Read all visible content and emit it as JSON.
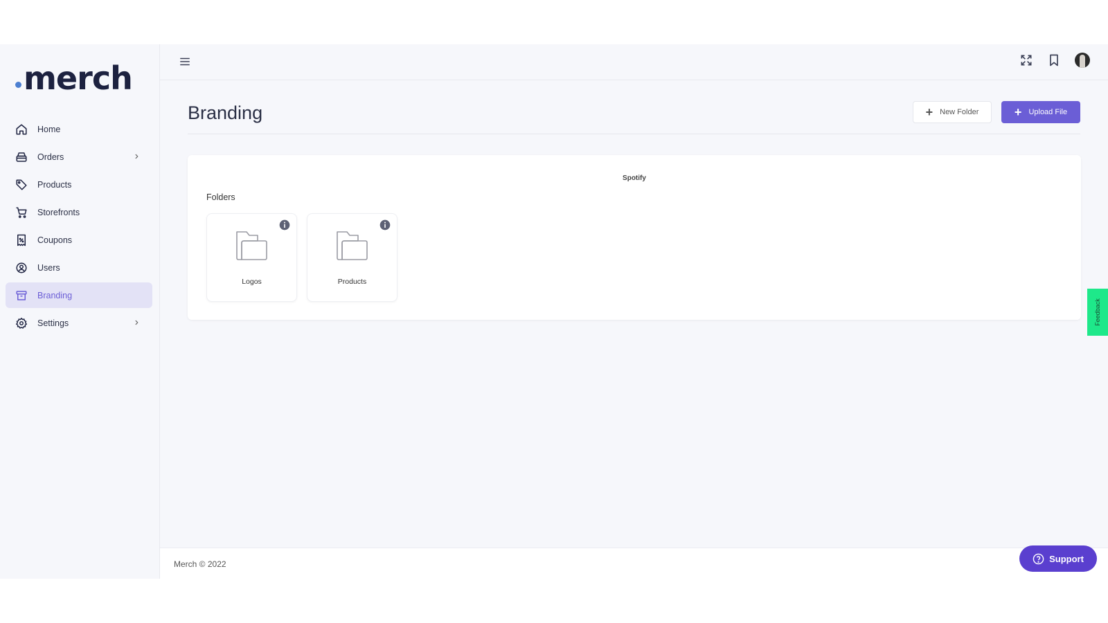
{
  "brand": {
    "logo_text": "merch",
    "accent": "#6b5ed6",
    "logo_dot_color": "#4c7fd1"
  },
  "sidebar": {
    "items": [
      {
        "label": "Home",
        "icon": "home-icon",
        "has_submenu": false,
        "active": false
      },
      {
        "label": "Orders",
        "icon": "orders-icon",
        "has_submenu": true,
        "active": false
      },
      {
        "label": "Products",
        "icon": "tag-icon",
        "has_submenu": false,
        "active": false
      },
      {
        "label": "Storefronts",
        "icon": "cart-icon",
        "has_submenu": false,
        "active": false
      },
      {
        "label": "Coupons",
        "icon": "coupon-icon",
        "has_submenu": false,
        "active": false
      },
      {
        "label": "Users",
        "icon": "user-circle-icon",
        "has_submenu": false,
        "active": false
      },
      {
        "label": "Branding",
        "icon": "archive-icon",
        "has_submenu": false,
        "active": true
      },
      {
        "label": "Settings",
        "icon": "gear-icon",
        "has_submenu": true,
        "active": false
      }
    ]
  },
  "topbar": {
    "icons": [
      "hamburger-menu-icon",
      "fullscreen-icon",
      "bookmark-icon",
      "avatar"
    ]
  },
  "page": {
    "title": "Branding",
    "new_folder_label": "New Folder",
    "upload_file_label": "Upload File"
  },
  "card": {
    "heading": "Spotify",
    "section_label": "Folders",
    "folders": [
      {
        "name": "Logos"
      },
      {
        "name": "Products"
      }
    ]
  },
  "footer": {
    "copyright": "Merch © 2022"
  },
  "feedback": {
    "label": "Feedback",
    "color": "#1ee88a"
  },
  "support": {
    "label": "Support",
    "color": "#5a3fcf"
  }
}
